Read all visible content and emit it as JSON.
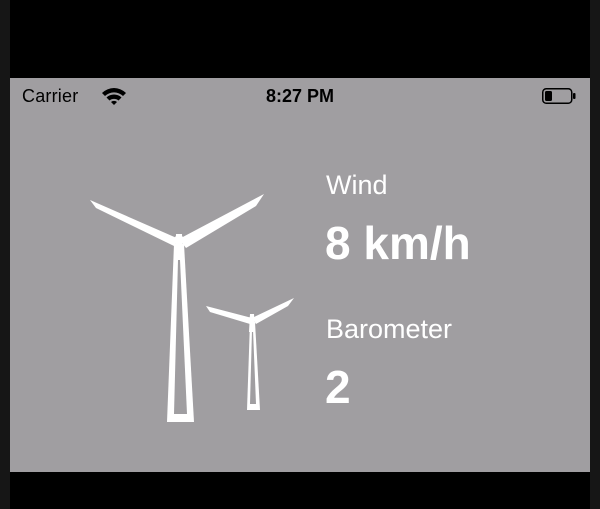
{
  "status_bar": {
    "carrier": "Carrier",
    "time": "8:27 PM",
    "icons": [
      "wifi-icon",
      "battery-icon"
    ]
  },
  "weather": {
    "wind_label": "Wind",
    "wind_value": "8 km/h",
    "barometer_label": "Barometer",
    "barometer_value": "2"
  },
  "illustration": {
    "icon": "wind-turbines-icon"
  },
  "colors": {
    "screen_background": "#a09ea1",
    "text": "#ffffff",
    "status_text": "#000000",
    "frame": "#000000"
  }
}
